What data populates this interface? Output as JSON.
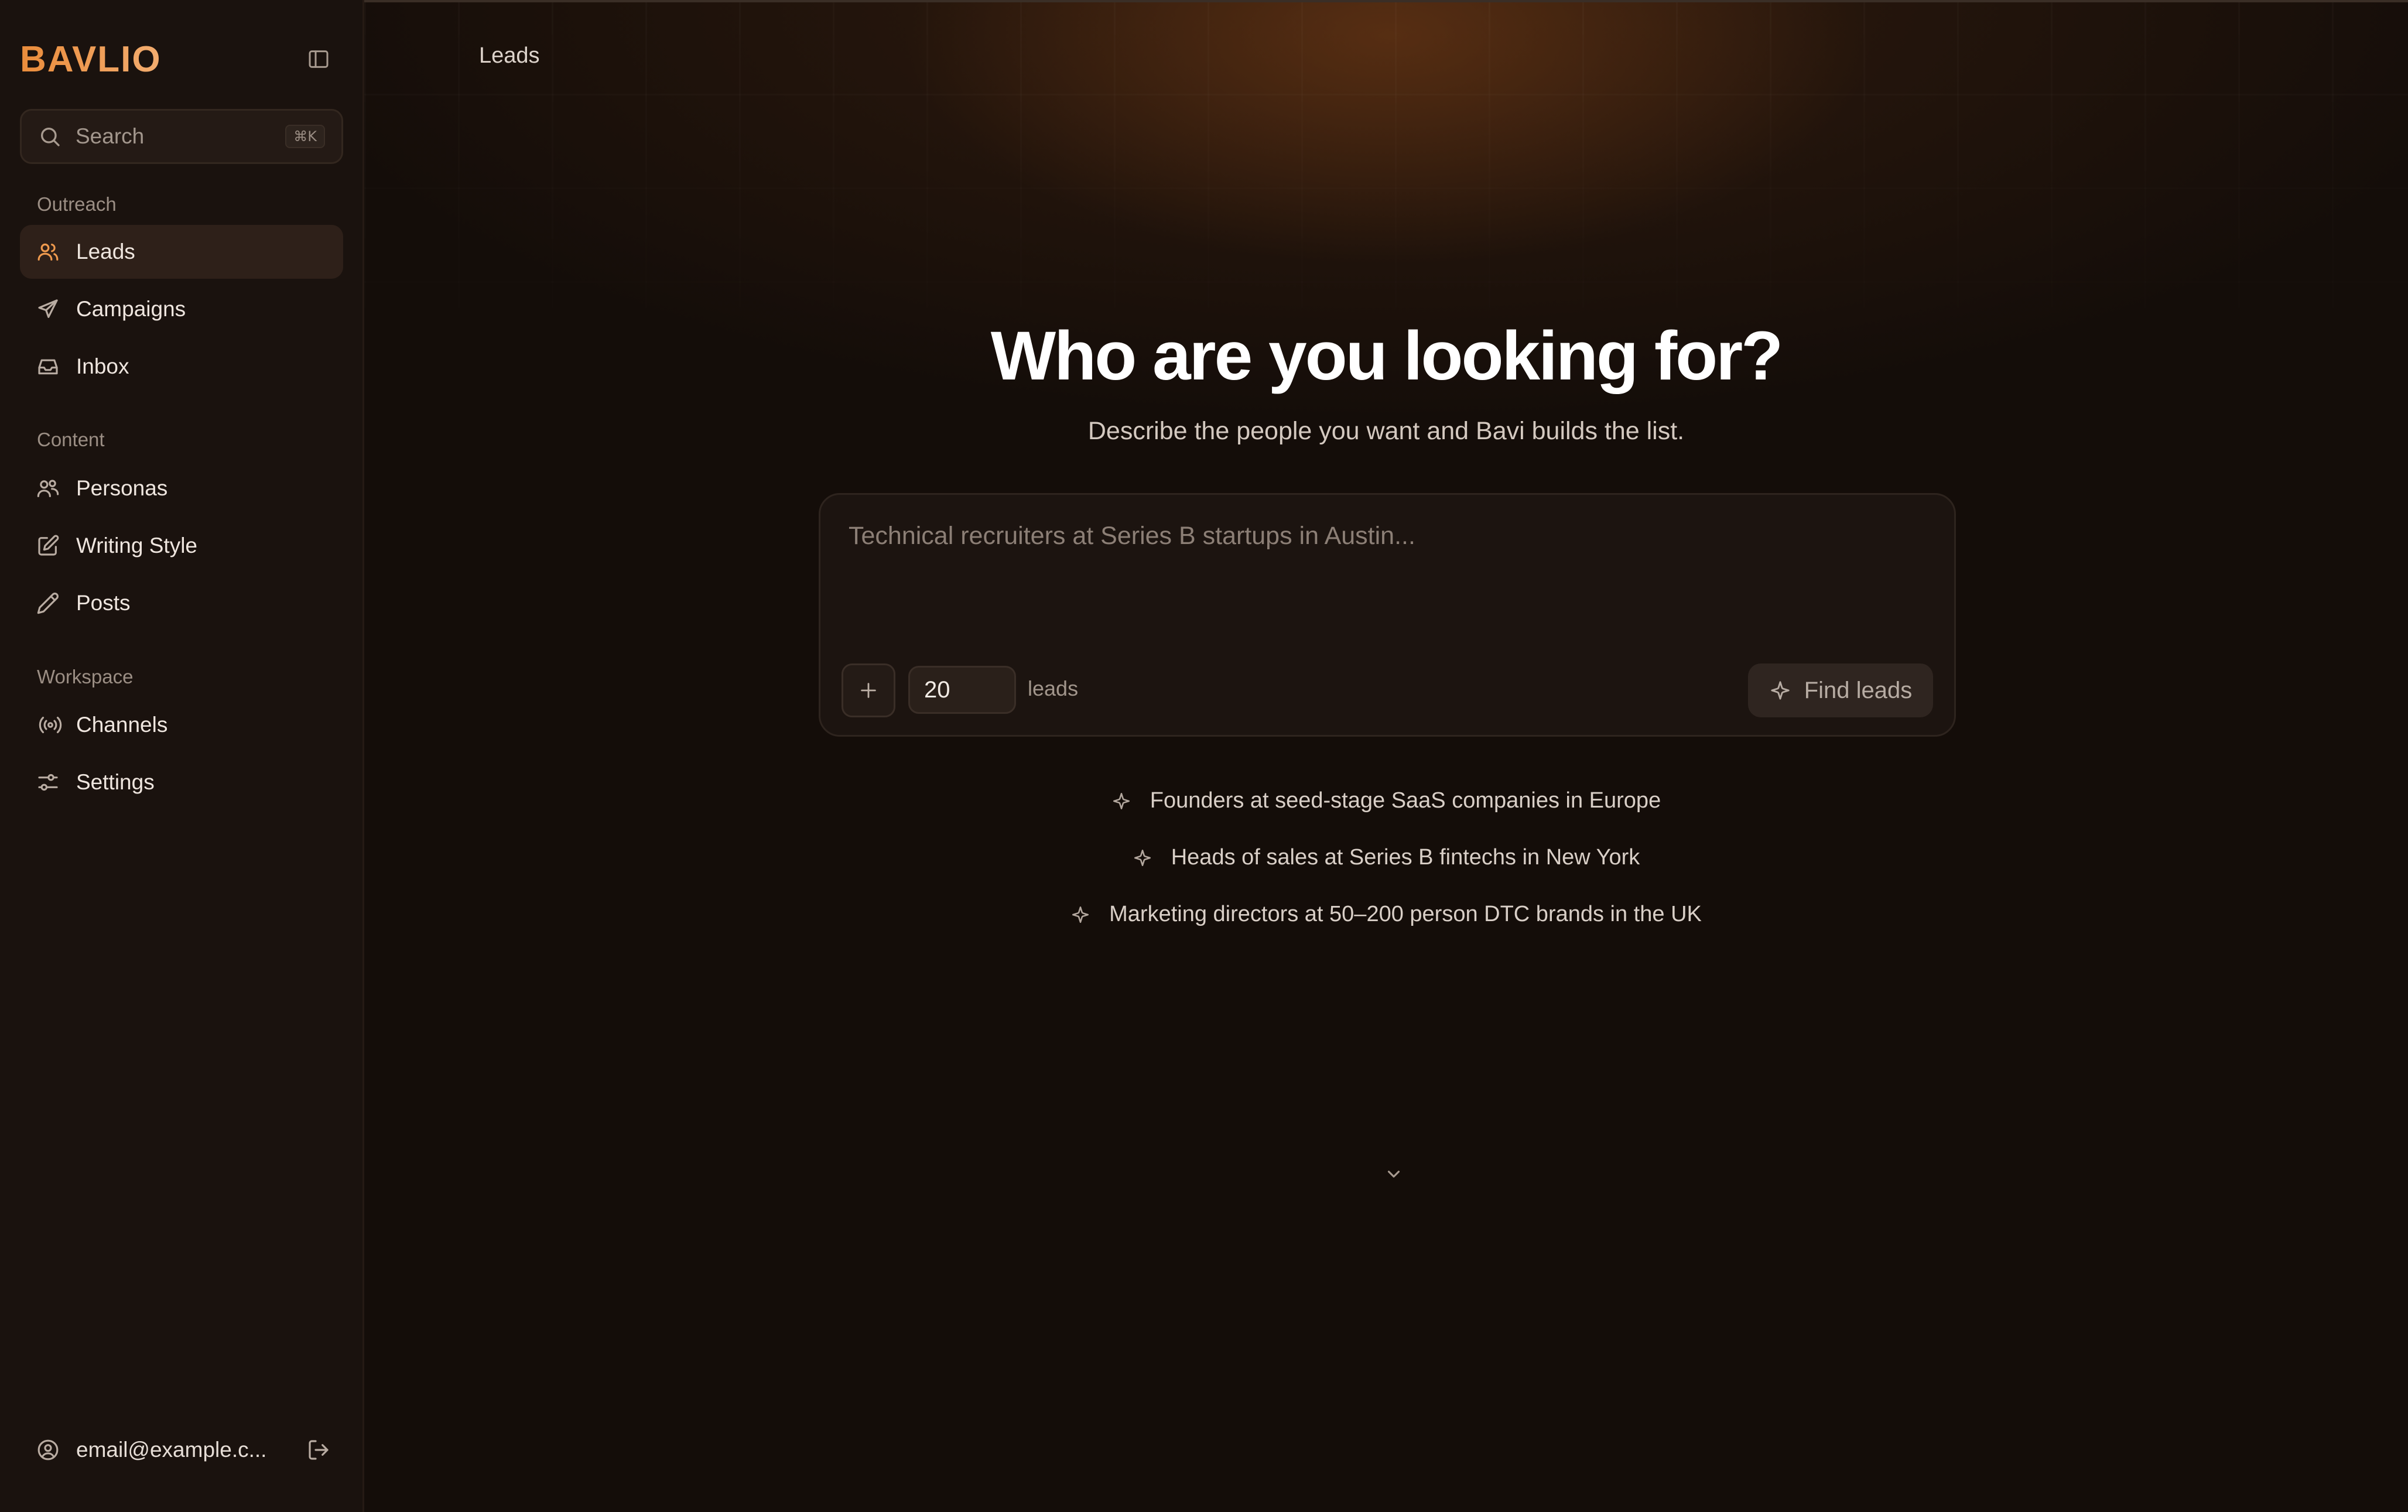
{
  "brand": {
    "name": "BAVLIO",
    "accent": "#ef9a4e"
  },
  "search": {
    "label": "Search",
    "shortcut": "⌘K"
  },
  "sidebar": {
    "sections": [
      {
        "title": "Outreach",
        "items": [
          {
            "label": "Leads",
            "icon": "users-icon",
            "active": true
          },
          {
            "label": "Campaigns",
            "icon": "send-icon"
          },
          {
            "label": "Inbox",
            "icon": "inbox-icon"
          }
        ]
      },
      {
        "title": "Content",
        "items": [
          {
            "label": "Personas",
            "icon": "personas-icon"
          },
          {
            "label": "Writing Style",
            "icon": "edit-icon"
          },
          {
            "label": "Posts",
            "icon": "pencil-icon"
          }
        ]
      },
      {
        "title": "Workspace",
        "items": [
          {
            "label": "Channels",
            "icon": "broadcast-icon"
          },
          {
            "label": "Settings",
            "icon": "sliders-icon"
          }
        ]
      }
    ],
    "footer": {
      "email": "email@example.c..."
    }
  },
  "header": {
    "breadcrumb": "Leads"
  },
  "hero": {
    "title": "Who are you looking for?",
    "subtitle": "Describe the people you want and Bavi builds the list."
  },
  "composer": {
    "placeholder": "Technical recruiters at Series B startups in Austin...",
    "lead_count": "20",
    "count_unit": "leads",
    "submit_label": "Find leads"
  },
  "suggestions": [
    "Founders at seed-stage SaaS companies in Europe",
    "Heads of sales at Series B fintechs in New York",
    "Marketing directors at 50–200 person DTC brands in the UK"
  ]
}
